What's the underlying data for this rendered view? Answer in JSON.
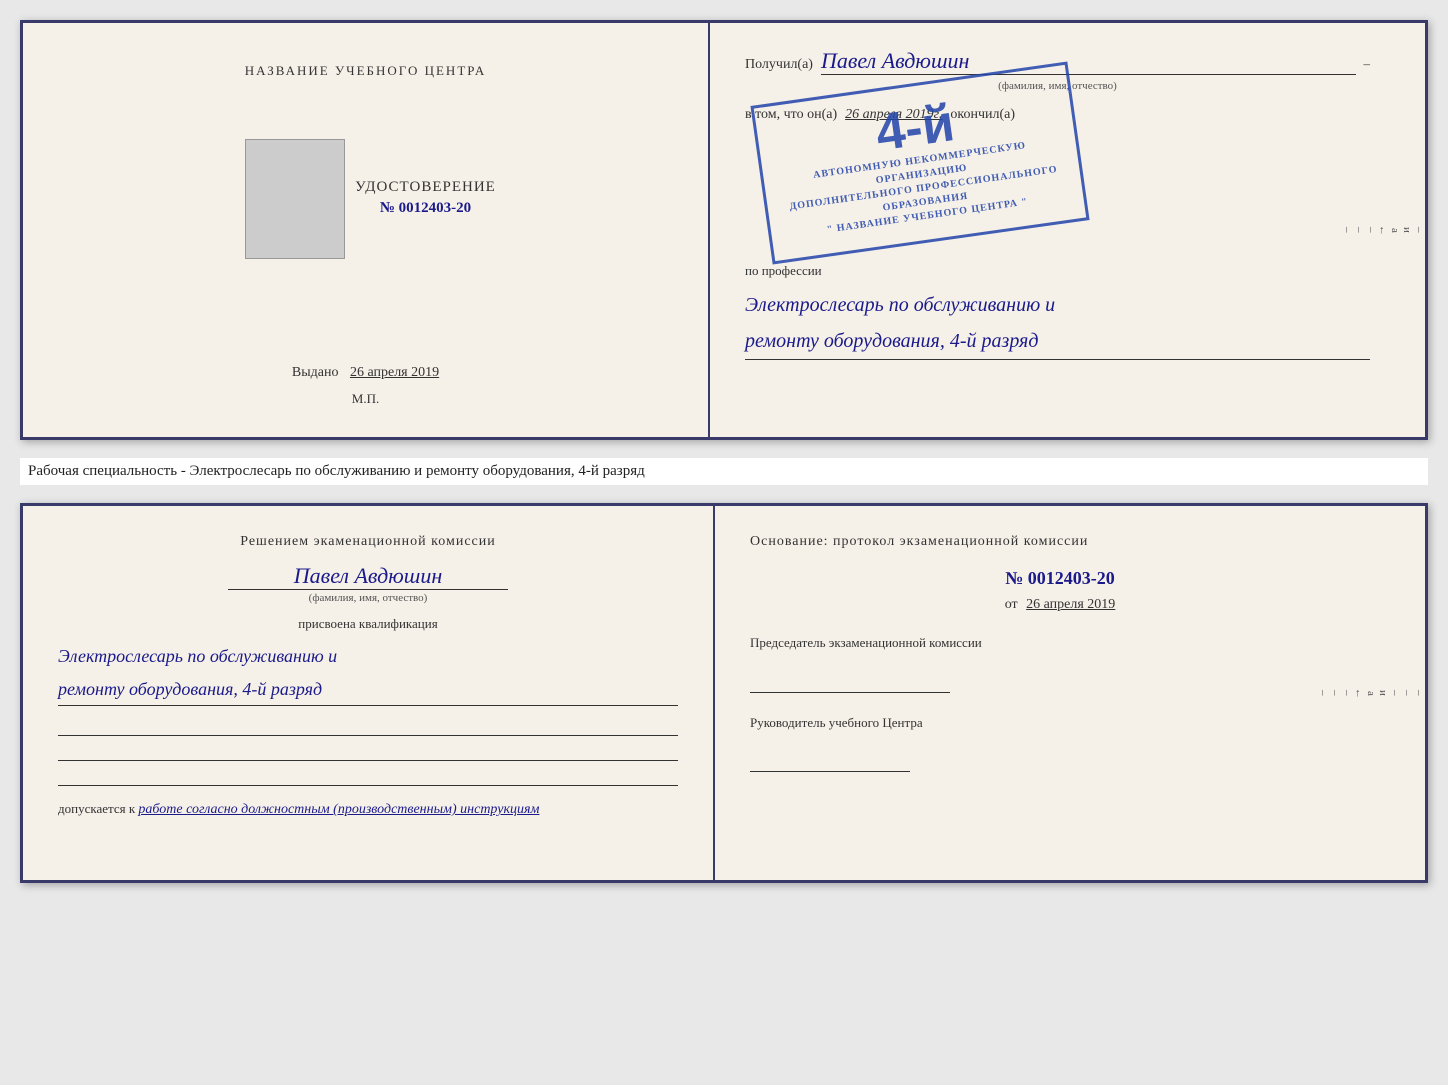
{
  "topCert": {
    "leftPanel": {
      "title": "НАЗВАНИЕ УЧЕБНОГО ЦЕНТРА",
      "certWord": "УДОСТОВЕРЕНИЕ",
      "certNumber": "№ 0012403-20",
      "issuedLabel": "Выдано",
      "issuedDate": "26 апреля 2019",
      "mpLabel": "М.П."
    },
    "rightPanel": {
      "receivedLabel": "Получил(а)",
      "recipientName": "Павел Авдюшин",
      "fioSubLabel": "(фамилия, имя, отчество)",
      "inThatLabel": "в том, что он(а)",
      "date": "26 апреля 2019г.",
      "finishedLabel": "окончил(а)",
      "stampGrade": "4-й",
      "stampLine1": "АВТОНОМНУЮ НЕКОММЕРЧЕСКУЮ ОРГАНИЗАЦИЮ",
      "stampLine2": "ДОПОЛНИТЕЛЬНОГО ПРОФЕССИОНАЛЬНОГО ОБРАЗОВАНИЯ",
      "stampLine3": "\" НАЗВАНИЕ УЧЕБНОГО ЦЕНТРА \"",
      "professionLabel": "по профессии",
      "professionLine1": "Электрослесарь по обслуживанию и",
      "professionLine2": "ремонту оборудования, 4-й разряд"
    }
  },
  "middleText": "Рабочая специальность - Электрослесарь по обслуживанию и ремонту оборудования, 4-й разряд",
  "bottomCert": {
    "leftPanel": {
      "decisionLine1": "Решением экаменационной комиссии",
      "recipientName": "Павел Авдюшин",
      "fioSubLabel": "(фамилия, имя, отчество)",
      "qualificationLabel": "присвоена квалификация",
      "qualLine1": "Электрослесарь по обслуживанию и",
      "qualLine2": "ремонту оборудования, 4-й разряд",
      "allowedPrefix": "допускается к",
      "allowedText": "работе согласно должностным (производственным) инструкциям"
    },
    "rightPanel": {
      "basisLabel": "Основание: протокол экзаменационной комиссии",
      "protocolNumber": "№ 0012403-20",
      "fromLabel": "от",
      "fromDate": "26 апреля 2019",
      "chairmanLabel": "Председатель экзаменационной комиссии",
      "directorLabel": "Руководитель учебного Центра"
    }
  },
  "rightStrip": {
    "chars": [
      "и",
      "а",
      "←",
      "–",
      "–",
      "–"
    ]
  }
}
